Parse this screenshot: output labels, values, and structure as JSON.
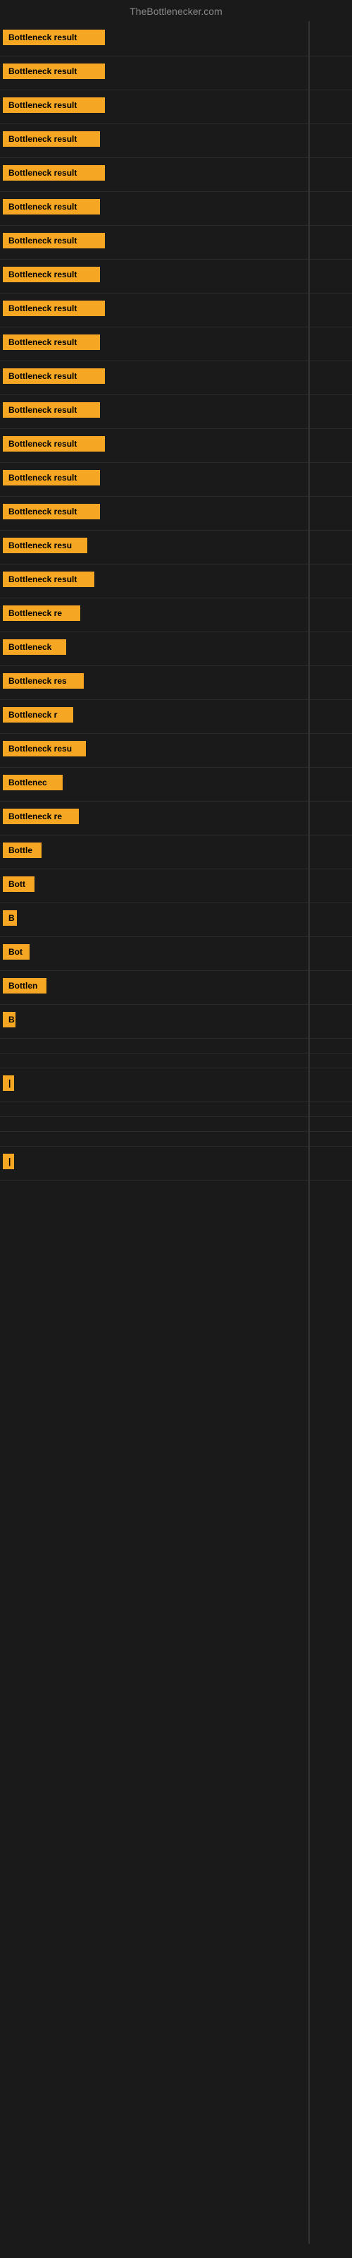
{
  "site": {
    "title": "TheBottlenecker.com"
  },
  "rows": [
    {
      "label": "Bottleneck result",
      "width": 145
    },
    {
      "label": "Bottleneck result",
      "width": 145
    },
    {
      "label": "Bottleneck result",
      "width": 145
    },
    {
      "label": "Bottleneck result",
      "width": 138
    },
    {
      "label": "Bottleneck result",
      "width": 145
    },
    {
      "label": "Bottleneck result",
      "width": 138
    },
    {
      "label": "Bottleneck result",
      "width": 145
    },
    {
      "label": "Bottleneck result",
      "width": 138
    },
    {
      "label": "Bottleneck result",
      "width": 145
    },
    {
      "label": "Bottleneck result",
      "width": 138
    },
    {
      "label": "Bottleneck result",
      "width": 145
    },
    {
      "label": "Bottleneck result",
      "width": 138
    },
    {
      "label": "Bottleneck result",
      "width": 145
    },
    {
      "label": "Bottleneck result",
      "width": 138
    },
    {
      "label": "Bottleneck result",
      "width": 138
    },
    {
      "label": "Bottleneck resu",
      "width": 120
    },
    {
      "label": "Bottleneck result",
      "width": 130
    },
    {
      "label": "Bottleneck re",
      "width": 110
    },
    {
      "label": "Bottleneck",
      "width": 90
    },
    {
      "label": "Bottleneck res",
      "width": 115
    },
    {
      "label": "Bottleneck r",
      "width": 100
    },
    {
      "label": "Bottleneck resu",
      "width": 118
    },
    {
      "label": "Bottlenec",
      "width": 85
    },
    {
      "label": "Bottleneck re",
      "width": 108
    },
    {
      "label": "Bottle",
      "width": 55
    },
    {
      "label": "Bott",
      "width": 45
    },
    {
      "label": "B",
      "width": 20
    },
    {
      "label": "Bot",
      "width": 38
    },
    {
      "label": "Bottlen",
      "width": 62
    },
    {
      "label": "B",
      "width": 18
    },
    {
      "label": "",
      "width": 0
    },
    {
      "label": "",
      "width": 0
    },
    {
      "label": "|",
      "width": 10
    },
    {
      "label": "",
      "width": 0
    },
    {
      "label": "",
      "width": 0
    },
    {
      "label": "",
      "width": 0
    },
    {
      "label": "|",
      "width": 10
    }
  ]
}
